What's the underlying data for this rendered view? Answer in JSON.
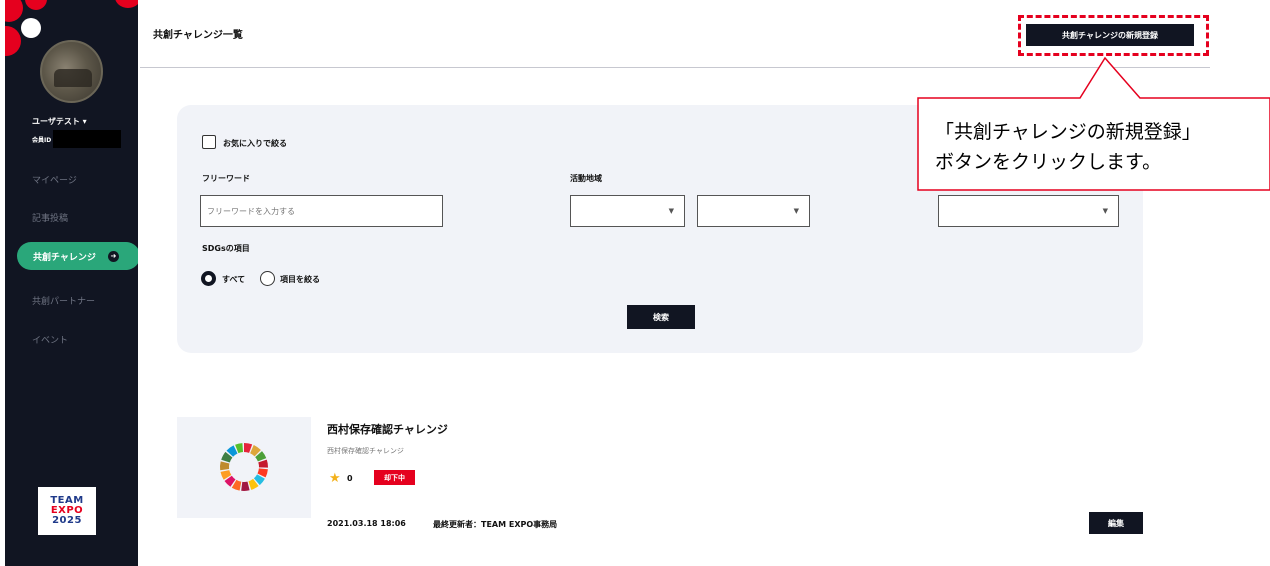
{
  "sidebar": {
    "user_name": "ユーザテスト ▾",
    "member_id_label": "会員ID",
    "items": [
      {
        "label": "マイページ"
      },
      {
        "label": "記事投稿"
      },
      {
        "label": "共創チャレンジ"
      },
      {
        "label": "共創パートナー"
      },
      {
        "label": "イベント"
      }
    ],
    "logo": {
      "line1": "TEAM",
      "line2": "EXPO",
      "line3": "2025"
    }
  },
  "header": {
    "title": "共創チャレンジ一覧",
    "new_button": "共創チャレンジの新規登録"
  },
  "callout": {
    "line1": "「共創チャレンジの新規登録」",
    "line2": "ボタンをクリックします。"
  },
  "search": {
    "favorites_label": "お気に入りで絞る",
    "freeword_label": "フリーワード",
    "freeword_placeholder": "フリーワードを入力する",
    "region_label": "活動地域",
    "sdgs_label": "SDGsの項目",
    "radio_all": "すべて",
    "radio_filter": "項目を絞る",
    "search_button": "検索"
  },
  "result": {
    "title": "西村保存確認チャレンジ",
    "subtitle": "西村保存確認チャレンジ",
    "favorite_count": "0",
    "status_badge": "却下中",
    "date": "2021.03.18 18:06",
    "updated_by": "最終更新者：TEAM EXPO事務局",
    "edit_button": "編集"
  },
  "colors": {
    "sidebar_bg": "#111522",
    "accent_green": "#2aa77a",
    "accent_red": "#e5001e",
    "panel_bg": "#f1f3f8"
  }
}
